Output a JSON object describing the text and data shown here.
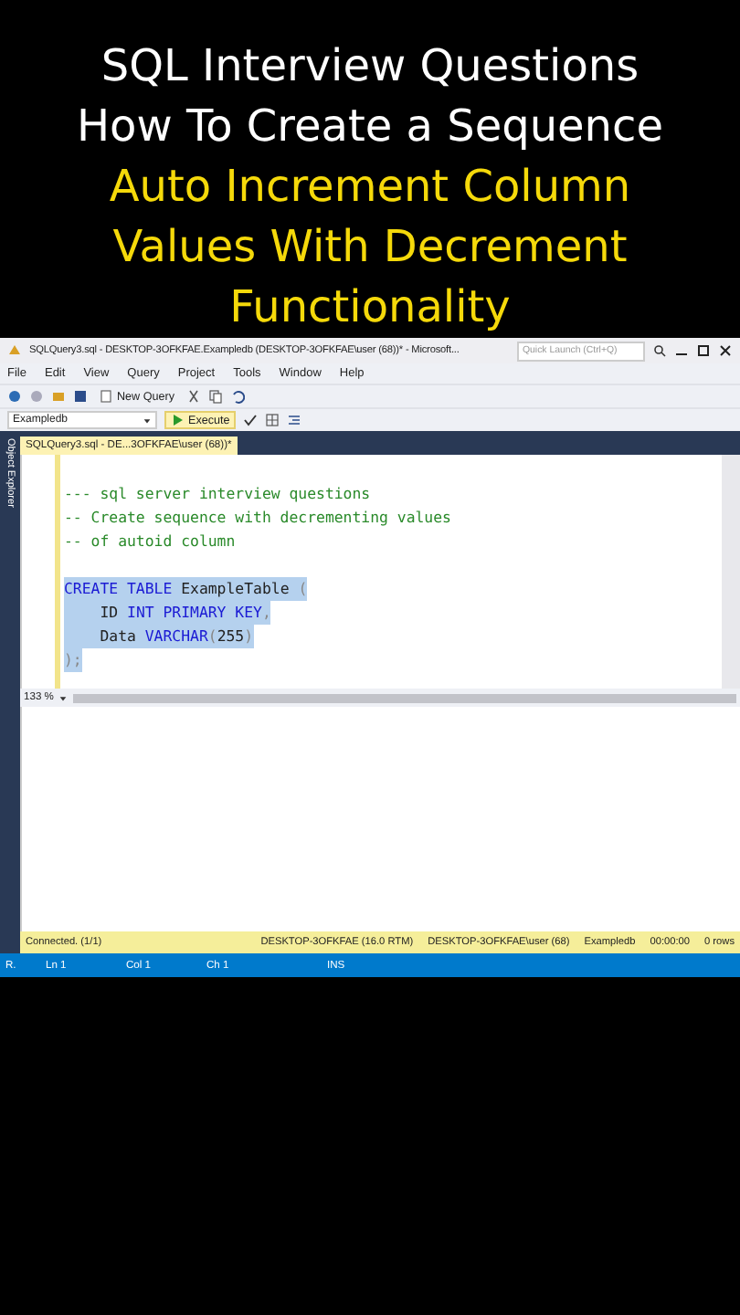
{
  "headline": [
    {
      "text": "SQL Interview Questions",
      "kind": "plain"
    },
    {
      "text": "How To Create a Sequence",
      "kind": "plain"
    },
    {
      "text": "Auto Increment Column",
      "kind": "highlight"
    },
    {
      "text": "Values With Decrement",
      "kind": "highlight"
    },
    {
      "text": "Functionality",
      "kind": "highlight"
    }
  ],
  "window": {
    "title": "SQLQuery3.sql - DESKTOP-3OFKFAE.Exampledb (DESKTOP-3OFKFAE\\user (68))* - Microsoft...",
    "quick_launch": {
      "placeholder": "Quick Launch (Ctrl+Q)"
    }
  },
  "menu": [
    "File",
    "Edit",
    "View",
    "Query",
    "Project",
    "Tools",
    "Window",
    "Help"
  ],
  "toolbar": {
    "new_query": "New Query",
    "database": "Exampledb",
    "execute": "Execute"
  },
  "sidebar": {
    "label": "Object Explorer"
  },
  "document_tab": {
    "label": "SQLQuery3.sql - DE...3OFKFAE\\user (68))*",
    "selected": true
  },
  "editor": {
    "lines": [
      {
        "selected": false,
        "tokens": [
          {
            "kind": "comment",
            "text": "--- sql server interview questions"
          }
        ]
      },
      {
        "selected": false,
        "tokens": [
          {
            "kind": "comment",
            "text": "-- Create sequence with decrementing values"
          }
        ]
      },
      {
        "selected": false,
        "tokens": [
          {
            "kind": "comment",
            "text": "-- of autoid column"
          }
        ]
      },
      {
        "selected": true,
        "gap_before": true,
        "tokens": [
          {
            "kind": "keyword",
            "text": "CREATE TABLE "
          },
          {
            "kind": "plain",
            "text": "ExampleTable "
          },
          {
            "kind": "punct",
            "text": "("
          }
        ]
      },
      {
        "selected": true,
        "tokens": [
          {
            "kind": "plain",
            "text": "    ID "
          },
          {
            "kind": "keyword",
            "text": "INT PRIMARY KEY"
          },
          {
            "kind": "punct",
            "text": ","
          }
        ]
      },
      {
        "selected": true,
        "tokens": [
          {
            "kind": "plain",
            "text": "    Data "
          },
          {
            "kind": "keyword",
            "text": "VARCHAR"
          },
          {
            "kind": "punct",
            "text": "("
          },
          {
            "kind": "plain",
            "text": "255"
          },
          {
            "kind": "punct",
            "text": ")"
          }
        ]
      },
      {
        "selected": true,
        "tokens": [
          {
            "kind": "punct",
            "text": ");"
          }
        ]
      }
    ],
    "zoom": "133 %"
  },
  "query_status": {
    "connection": "Connected. (1/1)",
    "server": "DESKTOP-3OFKFAE (16.0 RTM)",
    "user": "DESKTOP-3OFKFAE\\user (68)",
    "database": "Exampledb",
    "elapsed": "00:00:00",
    "rows": "0 rows"
  },
  "status_bar": {
    "state": "R.",
    "line": "Ln 1",
    "column": "Col 1",
    "char": "Ch 1",
    "mode": "INS"
  }
}
